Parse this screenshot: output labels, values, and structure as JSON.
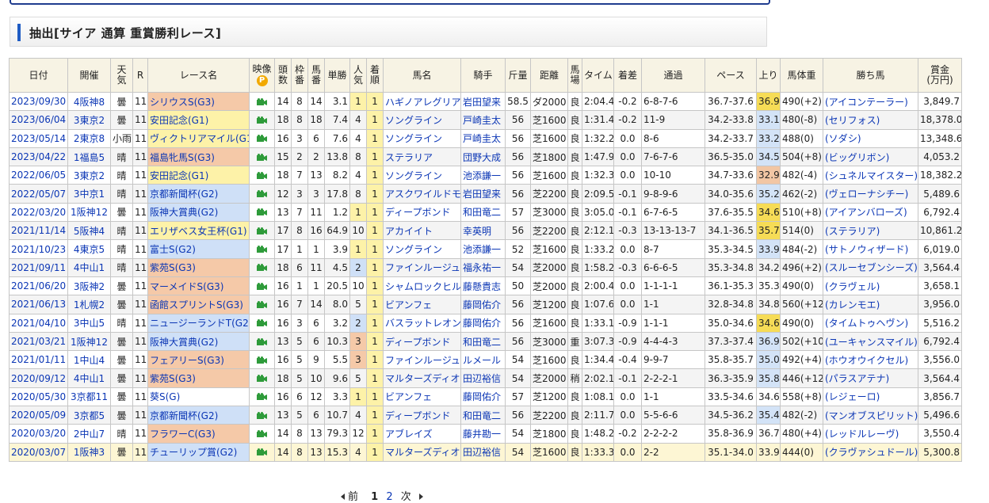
{
  "section": {
    "title": "抽出[サイア 通算 重賞勝利レース]"
  },
  "headers": {
    "date": "日付",
    "venue": "開催",
    "weather": "天\n気",
    "race_no": "R",
    "race_name": "レース名",
    "video": "映像",
    "video_p": "P",
    "runners": "頭\n数",
    "gate": "枠\n番",
    "number": "馬\n番",
    "odds": "単勝",
    "popularity": "人\n気",
    "finish": "着\n順",
    "horse": "馬名",
    "jockey": "騎手",
    "weight_carried": "斤量",
    "distance": "距離",
    "track": "馬\n場",
    "time": "タイム",
    "margin": "着差",
    "passing": "通過",
    "pace": "ペース",
    "last3f": "上り",
    "horse_weight": "馬体重",
    "winner": "勝ち馬",
    "prize": "賞金\n(万円)"
  },
  "rows": [
    {
      "date": "2023/09/30",
      "venue": "4阪神8",
      "weather": "曇",
      "r": "11",
      "race": "シリウスS(G3)",
      "grade": "g3",
      "runners": "14",
      "gate": "8",
      "number": "14",
      "odds": "3.1",
      "pop": "1",
      "fin": "1",
      "horse": "ハギノアレグリアス",
      "jockey": "岩田望来",
      "wt": "58.5",
      "dist": "ダ2000",
      "track": "良",
      "time": "2:04.4",
      "margin": "-0.2",
      "pass": "6-8-7-6",
      "pace": "36.7-37.6",
      "up": "36.9",
      "uprank": "1",
      "bw": "490(+2)",
      "winner": "(アイコンテーラー)",
      "prize": "3,849.7"
    },
    {
      "date": "2023/06/04",
      "venue": "3東京2",
      "weather": "曇",
      "r": "11",
      "race": "安田記念(G1)",
      "grade": "g1",
      "runners": "18",
      "gate": "8",
      "number": "18",
      "odds": "7.4",
      "pop": "4",
      "fin": "1",
      "horse": "ソングライン",
      "jockey": "戸崎圭太",
      "wt": "56",
      "dist": "芝1600",
      "track": "良",
      "time": "1:31.4",
      "margin": "-0.2",
      "pass": "11-9",
      "pace": "34.2-33.8",
      "up": "33.1",
      "uprank": "2",
      "bw": "480(-8)",
      "winner": "(セリフォス)",
      "prize": "18,378.0"
    },
    {
      "date": "2023/05/14",
      "venue": "2東京8",
      "weather": "小雨",
      "r": "11",
      "race": "ヴィクトリアマイル(G1)",
      "grade": "g1",
      "runners": "16",
      "gate": "3",
      "number": "6",
      "odds": "7.6",
      "pop": "4",
      "fin": "1",
      "horse": "ソングライン",
      "jockey": "戸崎圭太",
      "wt": "56",
      "dist": "芝1600",
      "track": "良",
      "time": "1:32.2",
      "margin": "0.0",
      "pass": "8-6",
      "pace": "34.2-33.7",
      "up": "33.2",
      "uprank": "2",
      "bw": "488(0)",
      "winner": "(ソダシ)",
      "prize": "13,348.6"
    },
    {
      "date": "2023/04/22",
      "venue": "1福島5",
      "weather": "晴",
      "r": "11",
      "race": "福島牝馬S(G3)",
      "grade": "g3",
      "runners": "15",
      "gate": "2",
      "number": "2",
      "odds": "13.8",
      "pop": "8",
      "fin": "1",
      "horse": "ステラリア",
      "jockey": "団野大成",
      "wt": "56",
      "dist": "芝1800",
      "track": "良",
      "time": "1:47.9",
      "margin": "0.0",
      "pass": "7-6-7-6",
      "pace": "36.5-35.0",
      "up": "34.5",
      "uprank": "2",
      "bw": "504(+8)",
      "winner": "(ビッグリボン)",
      "prize": "4,053.2"
    },
    {
      "date": "2022/06/05",
      "venue": "3東京2",
      "weather": "晴",
      "r": "11",
      "race": "安田記念(G1)",
      "grade": "g1",
      "runners": "18",
      "gate": "7",
      "number": "13",
      "odds": "8.2",
      "pop": "4",
      "fin": "1",
      "horse": "ソングライン",
      "jockey": "池添謙一",
      "wt": "56",
      "dist": "芝1600",
      "track": "良",
      "time": "1:32.3",
      "margin": "0.0",
      "pass": "10-10",
      "pace": "34.7-33.6",
      "up": "32.9",
      "uprank": "3",
      "bw": "482(-4)",
      "winner": "(シュネルマイスター)",
      "prize": "18,382.2"
    },
    {
      "date": "2022/05/07",
      "venue": "3中京1",
      "weather": "晴",
      "r": "11",
      "race": "京都新聞杯(G2)",
      "grade": "g2",
      "runners": "12",
      "gate": "3",
      "number": "3",
      "odds": "17.8",
      "pop": "8",
      "fin": "1",
      "horse": "アスクワイルドモア",
      "jockey": "岩田望来",
      "wt": "56",
      "dist": "芝2200",
      "track": "良",
      "time": "2:09.5",
      "margin": "-0.1",
      "pass": "9-8-9-6",
      "pace": "34.0-35.6",
      "up": "35.2",
      "uprank": "2",
      "bw": "462(-2)",
      "winner": "(ヴェローナシチー)",
      "prize": "5,489.6"
    },
    {
      "date": "2022/03/20",
      "venue": "1阪神12",
      "weather": "曇",
      "r": "11",
      "race": "阪神大賞典(G2)",
      "grade": "g2",
      "runners": "13",
      "gate": "7",
      "number": "11",
      "odds": "1.2",
      "pop": "1",
      "fin": "1",
      "horse": "ディープボンド",
      "jockey": "和田竜二",
      "wt": "57",
      "dist": "芝3000",
      "track": "良",
      "time": "3:05.0",
      "margin": "-0.1",
      "pass": "6-7-6-5",
      "pace": "37.6-35.5",
      "up": "34.6",
      "uprank": "1",
      "bw": "510(+8)",
      "winner": "(アイアンバローズ)",
      "prize": "6,792.4"
    },
    {
      "date": "2021/11/14",
      "venue": "5阪神4",
      "weather": "晴",
      "r": "11",
      "race": "エリザベス女王杯(G1)",
      "grade": "g1",
      "runners": "17",
      "gate": "8",
      "number": "16",
      "odds": "64.9",
      "pop": "10",
      "fin": "1",
      "horse": "アカイイト",
      "jockey": "幸英明",
      "wt": "56",
      "dist": "芝2200",
      "track": "良",
      "time": "2:12.1",
      "margin": "-0.3",
      "pass": "13-13-13-7",
      "pace": "34.1-36.5",
      "up": "35.7",
      "uprank": "1",
      "bw": "514(0)",
      "winner": "(ステラリア)",
      "prize": "10,861.2"
    },
    {
      "date": "2021/10/23",
      "venue": "4東京5",
      "weather": "晴",
      "r": "11",
      "race": "富士S(G2)",
      "grade": "g2",
      "runners": "17",
      "gate": "1",
      "number": "1",
      "odds": "3.9",
      "pop": "1",
      "fin": "1",
      "horse": "ソングライン",
      "jockey": "池添謙一",
      "wt": "52",
      "dist": "芝1600",
      "track": "良",
      "time": "1:33.2",
      "margin": "0.0",
      "pass": "8-7",
      "pace": "35.3-34.5",
      "up": "33.9",
      "uprank": "2",
      "bw": "484(-2)",
      "winner": "(サトノウィザード)",
      "prize": "6,019.0"
    },
    {
      "date": "2021/09/11",
      "venue": "4中山1",
      "weather": "晴",
      "r": "11",
      "race": "紫苑S(G3)",
      "grade": "g3",
      "runners": "18",
      "gate": "6",
      "number": "11",
      "odds": "4.5",
      "pop": "2",
      "fin": "1",
      "horse": "ファインルージュ",
      "jockey": "福永祐一",
      "wt": "54",
      "dist": "芝2000",
      "track": "良",
      "time": "1:58.2",
      "margin": "-0.3",
      "pass": "6-6-6-5",
      "pace": "35.3-34.8",
      "up": "34.2",
      "uprank": "0",
      "bw": "496(+2)",
      "winner": "(スルーセブンシーズ)",
      "prize": "3,564.4"
    },
    {
      "date": "2021/06/20",
      "venue": "3阪神2",
      "weather": "曇",
      "r": "11",
      "race": "マーメイドS(G3)",
      "grade": "g3",
      "runners": "16",
      "gate": "1",
      "number": "1",
      "odds": "20.5",
      "pop": "10",
      "fin": "1",
      "horse": "シャムロックヒル",
      "jockey": "藤懸貴志",
      "wt": "50",
      "dist": "芝2000",
      "track": "良",
      "time": "2:00.4",
      "margin": "0.0",
      "pass": "1-1-1-1",
      "pace": "36.1-35.3",
      "up": "35.3",
      "uprank": "0",
      "bw": "490(0)",
      "winner": "(クラヴェル)",
      "prize": "3,658.1"
    },
    {
      "date": "2021/06/13",
      "venue": "1札幌2",
      "weather": "曇",
      "r": "11",
      "race": "函館スプリントS(G3)",
      "grade": "g3",
      "runners": "16",
      "gate": "7",
      "number": "14",
      "odds": "8.0",
      "pop": "5",
      "fin": "1",
      "horse": "ビアンフェ",
      "jockey": "藤岡佑介",
      "wt": "56",
      "dist": "芝1200",
      "track": "良",
      "time": "1:07.6",
      "margin": "0.0",
      "pass": "1-1",
      "pace": "32.8-34.8",
      "up": "34.8",
      "uprank": "0",
      "bw": "560(+12)",
      "winner": "(カレンモエ)",
      "prize": "3,956.0"
    },
    {
      "date": "2021/04/10",
      "venue": "3中山5",
      "weather": "晴",
      "r": "11",
      "race": "ニュージーランドT(G2)",
      "grade": "g2",
      "runners": "16",
      "gate": "3",
      "number": "6",
      "odds": "3.2",
      "pop": "2",
      "fin": "1",
      "horse": "バスラットレオン",
      "jockey": "藤岡佑介",
      "wt": "56",
      "dist": "芝1600",
      "track": "良",
      "time": "1:33.1",
      "margin": "-0.9",
      "pass": "1-1-1",
      "pace": "35.0-34.6",
      "up": "34.6",
      "uprank": "1",
      "bw": "490(0)",
      "winner": "(タイムトゥヘヴン)",
      "prize": "5,516.2"
    },
    {
      "date": "2021/03/21",
      "venue": "1阪神12",
      "weather": "曇",
      "r": "11",
      "race": "阪神大賞典(G2)",
      "grade": "g2",
      "runners": "13",
      "gate": "5",
      "number": "6",
      "odds": "10.3",
      "pop": "3",
      "fin": "1",
      "horse": "ディープボンド",
      "jockey": "和田竜二",
      "wt": "56",
      "dist": "芝3000",
      "track": "重",
      "time": "3:07.3",
      "margin": "-0.9",
      "pass": "4-4-4-3",
      "pace": "37.3-37.4",
      "up": "36.9",
      "uprank": "2",
      "bw": "502(+10)",
      "winner": "(ユーキャンスマイル)",
      "prize": "6,792.4"
    },
    {
      "date": "2021/01/11",
      "venue": "1中山4",
      "weather": "曇",
      "r": "11",
      "race": "フェアリーS(G3)",
      "grade": "g3",
      "runners": "16",
      "gate": "5",
      "number": "9",
      "odds": "5.5",
      "pop": "3",
      "fin": "1",
      "horse": "ファインルージュ",
      "jockey": "ルメール",
      "wt": "54",
      "dist": "芝1600",
      "track": "良",
      "time": "1:34.4",
      "margin": "-0.4",
      "pass": "9-9-7",
      "pace": "35.8-35.7",
      "up": "35.0",
      "uprank": "2",
      "bw": "492(+4)",
      "winner": "(ホウオウイクセル)",
      "prize": "3,556.0"
    },
    {
      "date": "2020/09/12",
      "venue": "4中山1",
      "weather": "曇",
      "r": "11",
      "race": "紫苑S(G3)",
      "grade": "g3",
      "runners": "18",
      "gate": "5",
      "number": "10",
      "odds": "9.6",
      "pop": "5",
      "fin": "1",
      "horse": "マルターズディオサ",
      "jockey": "田辺裕信",
      "wt": "54",
      "dist": "芝2000",
      "track": "稍",
      "time": "2:02.1",
      "margin": "-0.1",
      "pass": "2-2-2-1",
      "pace": "36.3-35.9",
      "up": "35.8",
      "uprank": "2",
      "bw": "446(+12)",
      "winner": "(パラスアテナ)",
      "prize": "3,564.4"
    },
    {
      "date": "2020/05/30",
      "venue": "3京都11",
      "weather": "曇",
      "r": "11",
      "race": "葵S(G)",
      "grade": "",
      "runners": "16",
      "gate": "6",
      "number": "12",
      "odds": "3.3",
      "pop": "1",
      "fin": "1",
      "horse": "ビアンフェ",
      "jockey": "藤岡佑介",
      "wt": "57",
      "dist": "芝1200",
      "track": "良",
      "time": "1:08.1",
      "margin": "0.0",
      "pass": "1-1",
      "pace": "33.5-34.6",
      "up": "34.6",
      "uprank": "0",
      "bw": "558(+8)",
      "winner": "(レジェーロ)",
      "prize": "3,856.7"
    },
    {
      "date": "2020/05/09",
      "venue": "3京都5",
      "weather": "曇",
      "r": "11",
      "race": "京都新聞杯(G2)",
      "grade": "g2",
      "runners": "13",
      "gate": "5",
      "number": "6",
      "odds": "10.7",
      "pop": "4",
      "fin": "1",
      "horse": "ディープボンド",
      "jockey": "和田竜二",
      "wt": "56",
      "dist": "芝2200",
      "track": "良",
      "time": "2:11.7",
      "margin": "0.0",
      "pass": "5-5-6-6",
      "pace": "34.5-36.2",
      "up": "35.4",
      "uprank": "2",
      "bw": "482(-2)",
      "winner": "(マンオブスピリット)",
      "prize": "5,496.6"
    },
    {
      "date": "2020/03/20",
      "venue": "2中山7",
      "weather": "晴",
      "r": "11",
      "race": "フラワーC(G3)",
      "grade": "g3",
      "runners": "14",
      "gate": "8",
      "number": "13",
      "odds": "79.3",
      "pop": "12",
      "fin": "1",
      "horse": "アブレイズ",
      "jockey": "藤井勘一",
      "wt": "54",
      "dist": "芝1800",
      "track": "良",
      "time": "1:48.2",
      "margin": "-0.2",
      "pass": "2-2-2-2",
      "pace": "35.8-36.9",
      "up": "36.7",
      "uprank": "0",
      "bw": "480(+4)",
      "winner": "(レッドルレーヴ)",
      "prize": "3,550.4"
    },
    {
      "date": "2020/03/07",
      "venue": "1阪神3",
      "weather": "曇",
      "r": "11",
      "race": "チューリップ賞(G2)",
      "grade": "g2",
      "runners": "14",
      "gate": "8",
      "number": "13",
      "odds": "15.3",
      "pop": "4",
      "fin": "1",
      "horse": "マルターズディオサ",
      "jockey": "田辺裕信",
      "wt": "54",
      "dist": "芝1600",
      "track": "良",
      "time": "1:33.3",
      "margin": "0.0",
      "pass": "2-2",
      "pace": "35.1-34.0",
      "up": "33.9",
      "uprank": "0",
      "bw": "444(0)",
      "winner": "(クラヴァシュドール)",
      "prize": "5,300.8"
    }
  ],
  "pager": {
    "prev": "前",
    "page1": "1",
    "page2": "2",
    "next": "次"
  },
  "icons": {
    "video": "video-camera-icon",
    "p_badge": "p-badge-icon"
  },
  "colors": {
    "link": "#0b36b5",
    "g1": "#fdf2a8",
    "g2": "#cfe0f7",
    "g3": "#f5c9a8",
    "header_bg": "#f7f3e4"
  }
}
